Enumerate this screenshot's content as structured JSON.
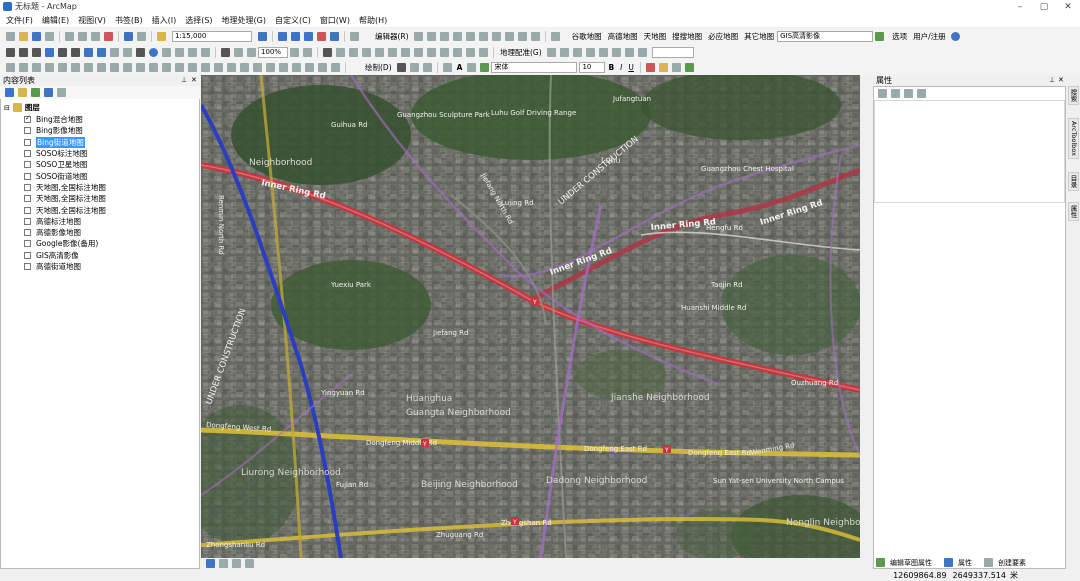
{
  "window": {
    "title": "无标题 - ArcMap",
    "controls": [
      "–",
      "▢",
      "✕"
    ]
  },
  "menu": [
    "文件(F)",
    "编辑(E)",
    "视图(V)",
    "书签(B)",
    "插入(I)",
    "选择(S)",
    "地理处理(G)",
    "自定义(C)",
    "窗口(W)",
    "帮助(H)"
  ],
  "toolbar1": {
    "scale": "1:15,000",
    "editor": "编辑器(R)",
    "basemaps": [
      "谷歌地图",
      "高德地图",
      "天地图",
      "搜搜地图",
      "必应地图",
      "其它地图"
    ],
    "gis_dropdown": "GIS高清影像",
    "options": "选项",
    "user": "用户/注册"
  },
  "toolbar2": {
    "zoom": "100%",
    "georef": "地理配准(G)"
  },
  "toolbar3": {
    "draw": "绘制(D)",
    "font": "宋体",
    "font_size": "10",
    "bold": "B",
    "italic": "I",
    "underline": "U",
    "text_label": "A"
  },
  "toc": {
    "title": "内容列表",
    "root": "图层",
    "layers": [
      {
        "name": "Bing混合地图",
        "checked": true,
        "selected": false
      },
      {
        "name": "Bing影像地图",
        "checked": false,
        "selected": false
      },
      {
        "name": "Bing街道地图",
        "checked": false,
        "selected": true
      },
      {
        "name": "SOSO标注地图",
        "checked": false,
        "selected": false
      },
      {
        "name": "SOSO卫星地图",
        "checked": false,
        "selected": false
      },
      {
        "name": "SOSO街道地图",
        "checked": false,
        "selected": false
      },
      {
        "name": "天地图,全国标注地图",
        "checked": false,
        "selected": false
      },
      {
        "name": "天地图,全国标注地图",
        "checked": false,
        "selected": false
      },
      {
        "name": "天地图,全国标注地图",
        "checked": false,
        "selected": false
      },
      {
        "name": "高德标注地图",
        "checked": false,
        "selected": false
      },
      {
        "name": "高德影像地图",
        "checked": false,
        "selected": false
      },
      {
        "name": "Google影像(备用)",
        "checked": false,
        "selected": false
      },
      {
        "name": "GIS高清影像",
        "checked": false,
        "selected": false
      },
      {
        "name": "高德街道地图",
        "checked": false,
        "selected": false
      }
    ]
  },
  "map": {
    "labels": {
      "guangzhou_sculpture_park": "Guangzhou Sculpture Park",
      "luhu_golf": "Luhu Golf Driving Range",
      "jufangtuan": "Jufangtuan",
      "guangzhou_chest_hospital": "Guangzhou Chest Hospital",
      "inner_ring_rd_1": "Inner Ring Rd",
      "inner_ring_rd_2": "Inner Ring Rd",
      "inner_ring_rd_3": "Inner Ring Rd",
      "inner_ring_rd_4": "Inner Ring Rd",
      "under_construction_1": "UNDER CONSTRUCTION",
      "under_construction_2": "UNDER CONSTRUCTION",
      "yuexiu_park": "Yuexiu Park",
      "neighborhood_top": "Neighborhood",
      "huanghua": "Huanghua",
      "jianshe": "Jianshe Neighborhood",
      "guangta": "Guangta Neighborhood",
      "dongfeng_west": "Dongfeng West Rd",
      "dongfeng_middle": "Dongfeng Middle Rd",
      "dongfeng_east_1": "Dongfeng East Rd",
      "dongfeng_east_2": "Dongfeng East Rd",
      "liurong": "Liurong Neighborhood",
      "beijing": "Beijing Neighborhood",
      "dadong": "Dadong Neighborhood",
      "zhongshan_rd": "Zhongshan Rd",
      "zhongshanliu": "Zhongshanliu Rd",
      "zhuguang": "Zhuguang Rd",
      "sysu": "Sun Yat-sen University North Campus",
      "nonglin": "Nonglin Neighborhood",
      "huanshi": "Huanshi Middle Rd",
      "hengfu": "Hengfu Rd",
      "guihua": "Guihua Rd",
      "lujing": "Lujing Rd",
      "jiefang_n": "Jiefang North Rd",
      "renmin_n": "Renmin North Rd",
      "fujian": "Fujian Rd",
      "yingyuan": "Yingyuan Rd",
      "wenming": "Wenming Rd",
      "ouzhuang": "Ouzhuang Rd",
      "luhu": "Luhu",
      "taojin": "Taojin Rd",
      "jiefang_s": "Jiefang Rd",
      "metro_y": "Y"
    }
  },
  "properties": {
    "title": "属性",
    "footer": [
      "编辑草图属性",
      "属性",
      "创建要素"
    ]
  },
  "side_tabs": [
    "搜索",
    "ArcToolbox",
    "目录",
    "属性"
  ],
  "status": {
    "x": "12609864.89",
    "y": "2649337.514",
    "unit": "米"
  },
  "colors": {
    "accent": "#3399ff",
    "road_red": "#c8343e",
    "road_yellow": "#e0c236",
    "metro_blue": "#2b3ec0",
    "metro_purple": "#a46ec4"
  }
}
